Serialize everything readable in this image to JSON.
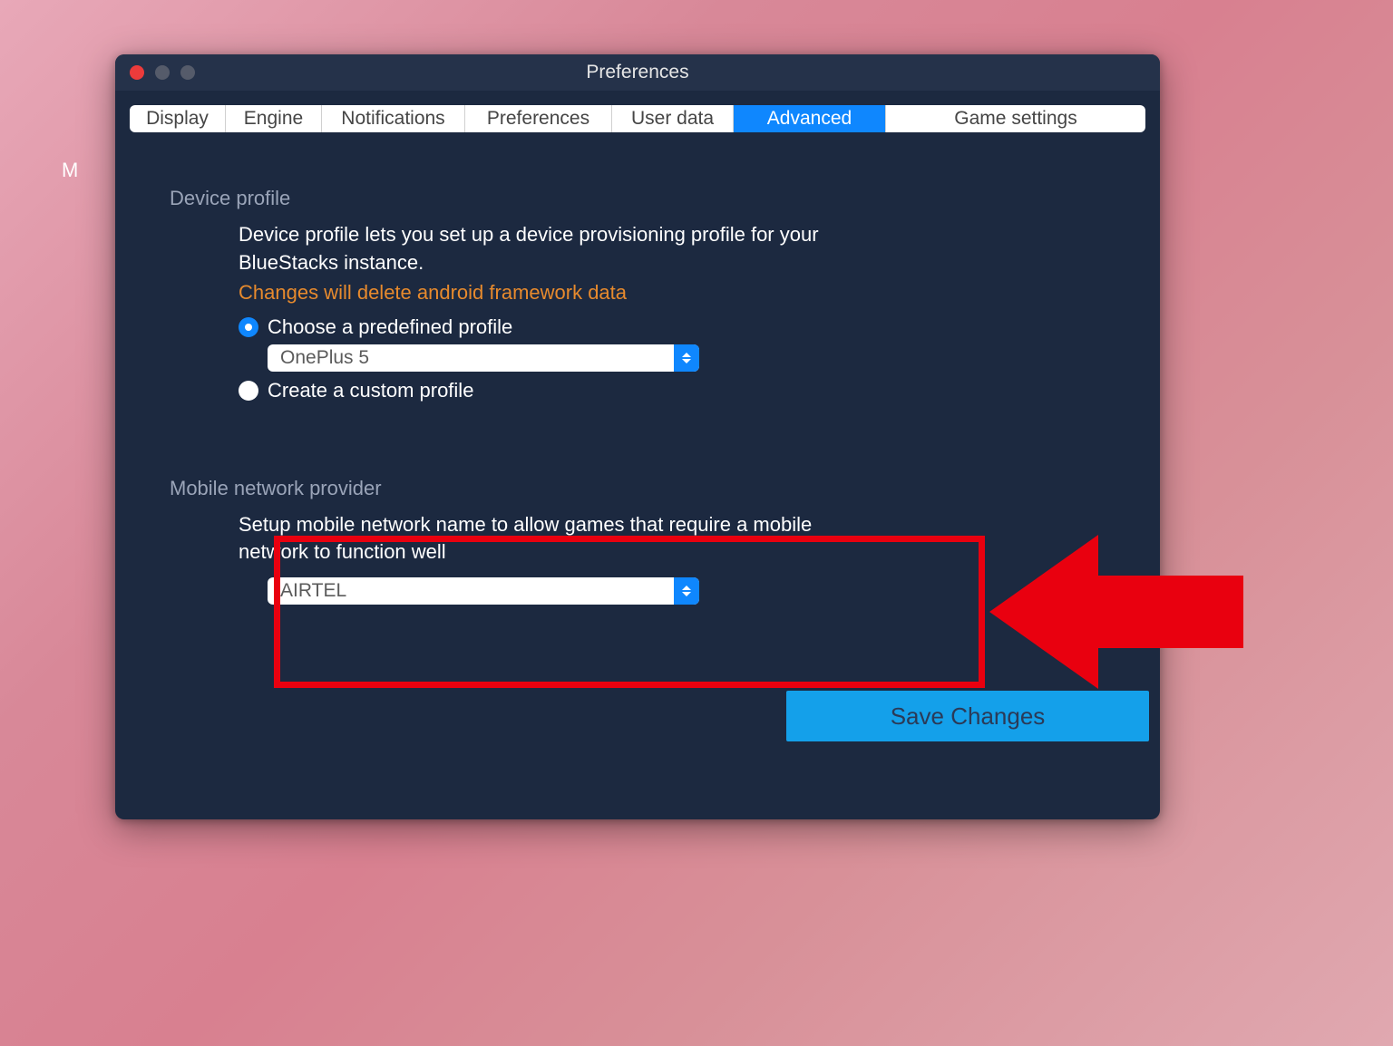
{
  "bg_letter": "M",
  "window": {
    "title": "Preferences"
  },
  "tabs": {
    "display": "Display",
    "engine": "Engine",
    "notifications": "Notifications",
    "preferences": "Preferences",
    "user_data": "User data",
    "advanced": "Advanced",
    "game_settings": "Game settings"
  },
  "device_profile": {
    "title": "Device profile",
    "desc": "Device profile lets you set up a device provisioning profile for your BlueStacks instance.",
    "warn": "Changes will delete android framework data",
    "choose_label": "Choose a predefined profile",
    "predefined_value": "OnePlus 5",
    "custom_label": "Create a custom profile"
  },
  "mobile_network": {
    "title": "Mobile network provider",
    "desc": "Setup mobile network name to allow games that require a mobile network to function well",
    "value": "AIRTEL"
  },
  "save_button": "Save Changes"
}
